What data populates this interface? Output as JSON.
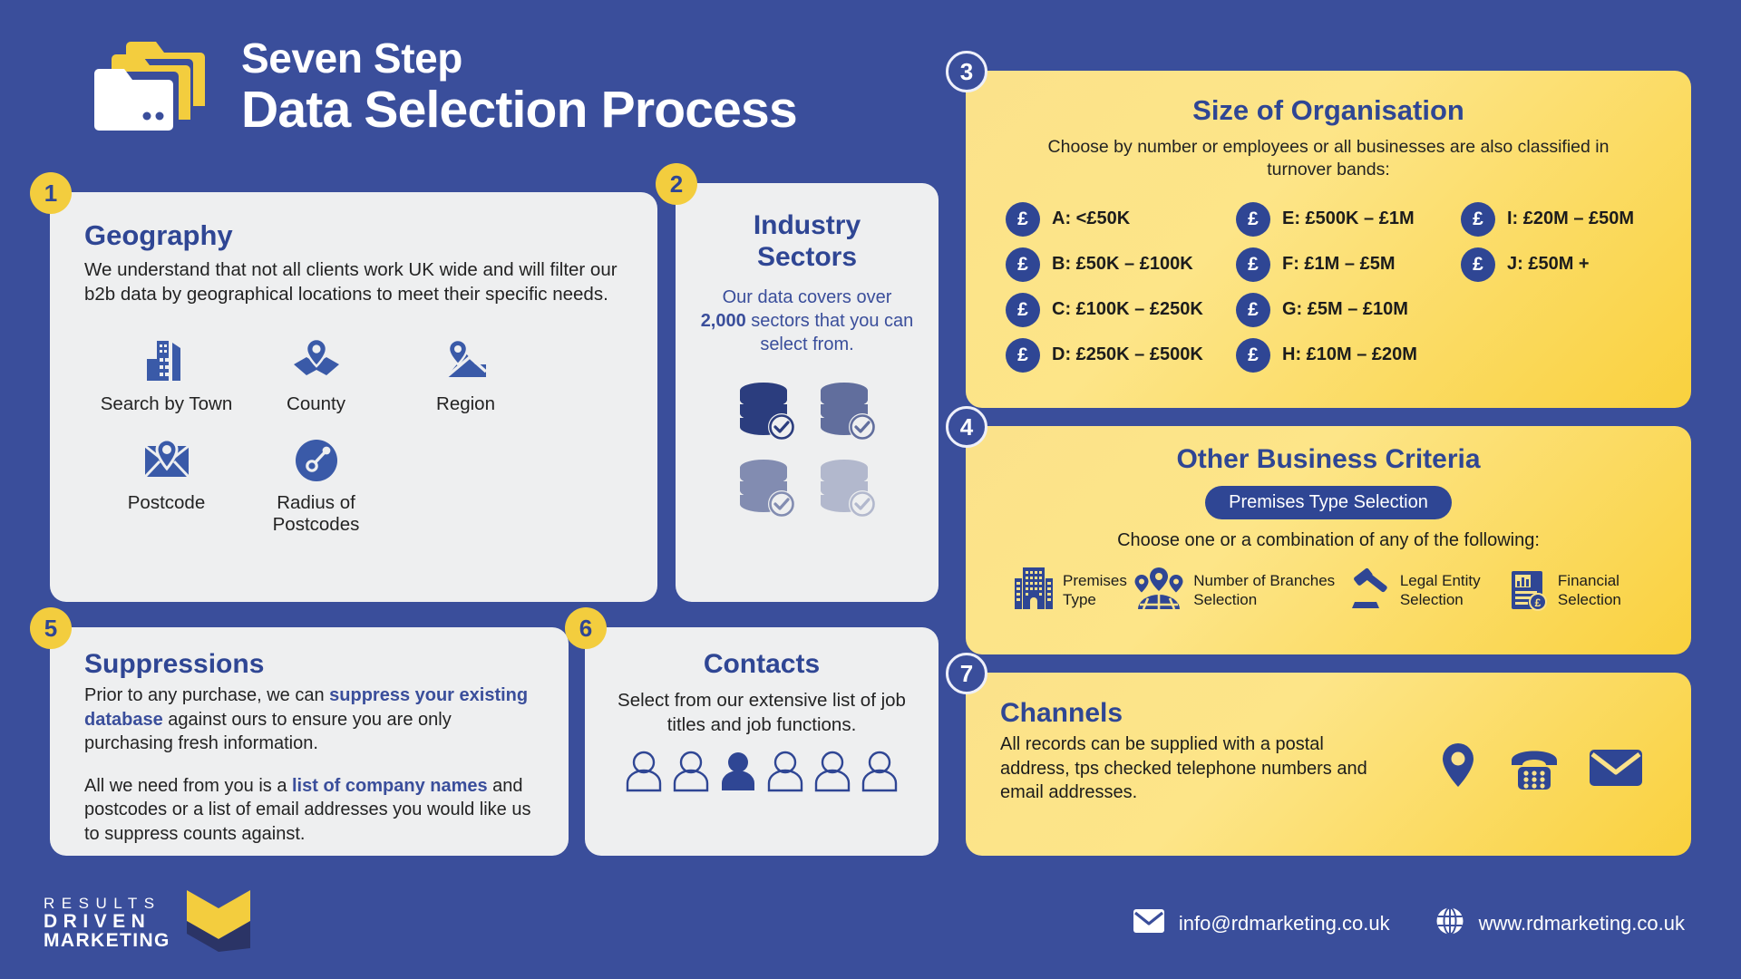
{
  "theme": {
    "background": "#3a4e9b",
    "card_light": "#eeeff0",
    "card_yellow": "#f9d93e",
    "accent_blue": "#2f4694",
    "accent_yellow": "#f3cd3e",
    "text_dark": "#232323",
    "white": "#ffffff"
  },
  "header": {
    "title_top": "Seven Step",
    "title_main": "Data Selection Process",
    "logo_icon": "folders-icon"
  },
  "steps": [
    {
      "number": "1",
      "title": "Geography",
      "body": "We understand that not all clients work UK wide and will filter our b2b data by geographical locations to meet their specific needs.",
      "items": [
        {
          "label": "Search by Town",
          "icon": "buildings-icon"
        },
        {
          "label": "County",
          "icon": "map-pin-folded-icon"
        },
        {
          "label": "Region",
          "icon": "map-region-pin-icon"
        },
        {
          "label": "Postcode",
          "icon": "postcode-envelope-pin-icon"
        },
        {
          "label": "Radius of Postcodes",
          "icon": "radius-target-icon"
        }
      ]
    },
    {
      "number": "2",
      "title_line1": "Industry",
      "title_line2": "Sectors",
      "body_pre": "Our data covers over ",
      "body_strong": "2,000",
      "body_post": " sectors that you can select from.",
      "databases": [
        {
          "icon": "database-check-icon",
          "opacity": "1"
        },
        {
          "icon": "database-check-icon",
          "opacity": "0.72"
        },
        {
          "icon": "database-check-icon",
          "opacity": "0.55"
        },
        {
          "icon": "database-check-icon",
          "opacity": "0.3"
        }
      ]
    },
    {
      "number": "3",
      "title": "Size of Organisation",
      "subtitle": "Choose by number or employees or all businesses are also classified in turnover bands:",
      "bands": [
        {
          "icon": "pound-icon",
          "symbol": "£",
          "label": "A: <£50K"
        },
        {
          "icon": "pound-icon",
          "symbol": "£",
          "label": "E: £500K – £1M"
        },
        {
          "icon": "pound-icon",
          "symbol": "£",
          "label": "I: £20M – £50M"
        },
        {
          "icon": "pound-icon",
          "symbol": "£",
          "label": "B: £50K – £100K"
        },
        {
          "icon": "pound-icon",
          "symbol": "£",
          "label": "F: £1M – £5M"
        },
        {
          "icon": "pound-icon",
          "symbol": "£",
          "label": "J: £50M +"
        },
        {
          "icon": "pound-icon",
          "symbol": "£",
          "label": "C: £100K – £250K"
        },
        {
          "icon": "pound-icon",
          "symbol": "£",
          "label": "G: £5M – £10M"
        },
        {
          "icon": "",
          "symbol": "",
          "label": ""
        },
        {
          "icon": "pound-icon",
          "symbol": "£",
          "label": "D: £250K – £500K"
        },
        {
          "icon": "pound-icon",
          "symbol": "£",
          "label": "H: £10M – £20M"
        },
        {
          "icon": "",
          "symbol": "",
          "label": ""
        }
      ]
    },
    {
      "number": "4",
      "title": "Other Business Criteria",
      "pill": "Premises Type Selection",
      "subtitle": "Choose one or a combination of any of the following:",
      "criteria": [
        {
          "label": "Premises Type",
          "icon": "office-building-icon"
        },
        {
          "label": "Number of Branches Selection",
          "icon": "multi-location-pins-icon"
        },
        {
          "label": "Legal Entity Selection",
          "icon": "gavel-icon"
        },
        {
          "label": "Financial Selection",
          "icon": "financial-report-pound-icon"
        }
      ]
    },
    {
      "number": "5",
      "title": "Suppressions",
      "p1_pre": "Prior to any purchase, we can ",
      "p1_strong": "suppress your existing database",
      "p1_post": " against ours to ensure you are only purchasing fresh information.",
      "p2_pre": "All we need from you is a ",
      "p2_strong": "list of company names",
      "p2_post": " and postcodes or a list of email addresses you would like us to suppress counts against."
    },
    {
      "number": "6",
      "title": "Contacts",
      "body": "Select from our extensive list of job titles and job functions.",
      "people_icons": [
        "person-icon",
        "person-icon",
        "person-filled-icon",
        "person-icon",
        "person-icon",
        "person-icon"
      ]
    },
    {
      "number": "7",
      "title": "Channels",
      "body": "All records can be supplied with a postal address, tps checked telephone numbers and email addresses.",
      "channel_icons": [
        "location-pin-icon",
        "telephone-icon",
        "envelope-icon"
      ]
    }
  ],
  "footer": {
    "logo_line1": "RESULTS",
    "logo_line2": "DRIVEN",
    "logo_line3": "MARKETING",
    "logo_mark": "chevron-mark-icon",
    "email_icon": "envelope-icon",
    "email": "info@rdmarketing.co.uk",
    "web_icon": "globe-icon",
    "website": "www.rdmarketing.co.uk"
  }
}
